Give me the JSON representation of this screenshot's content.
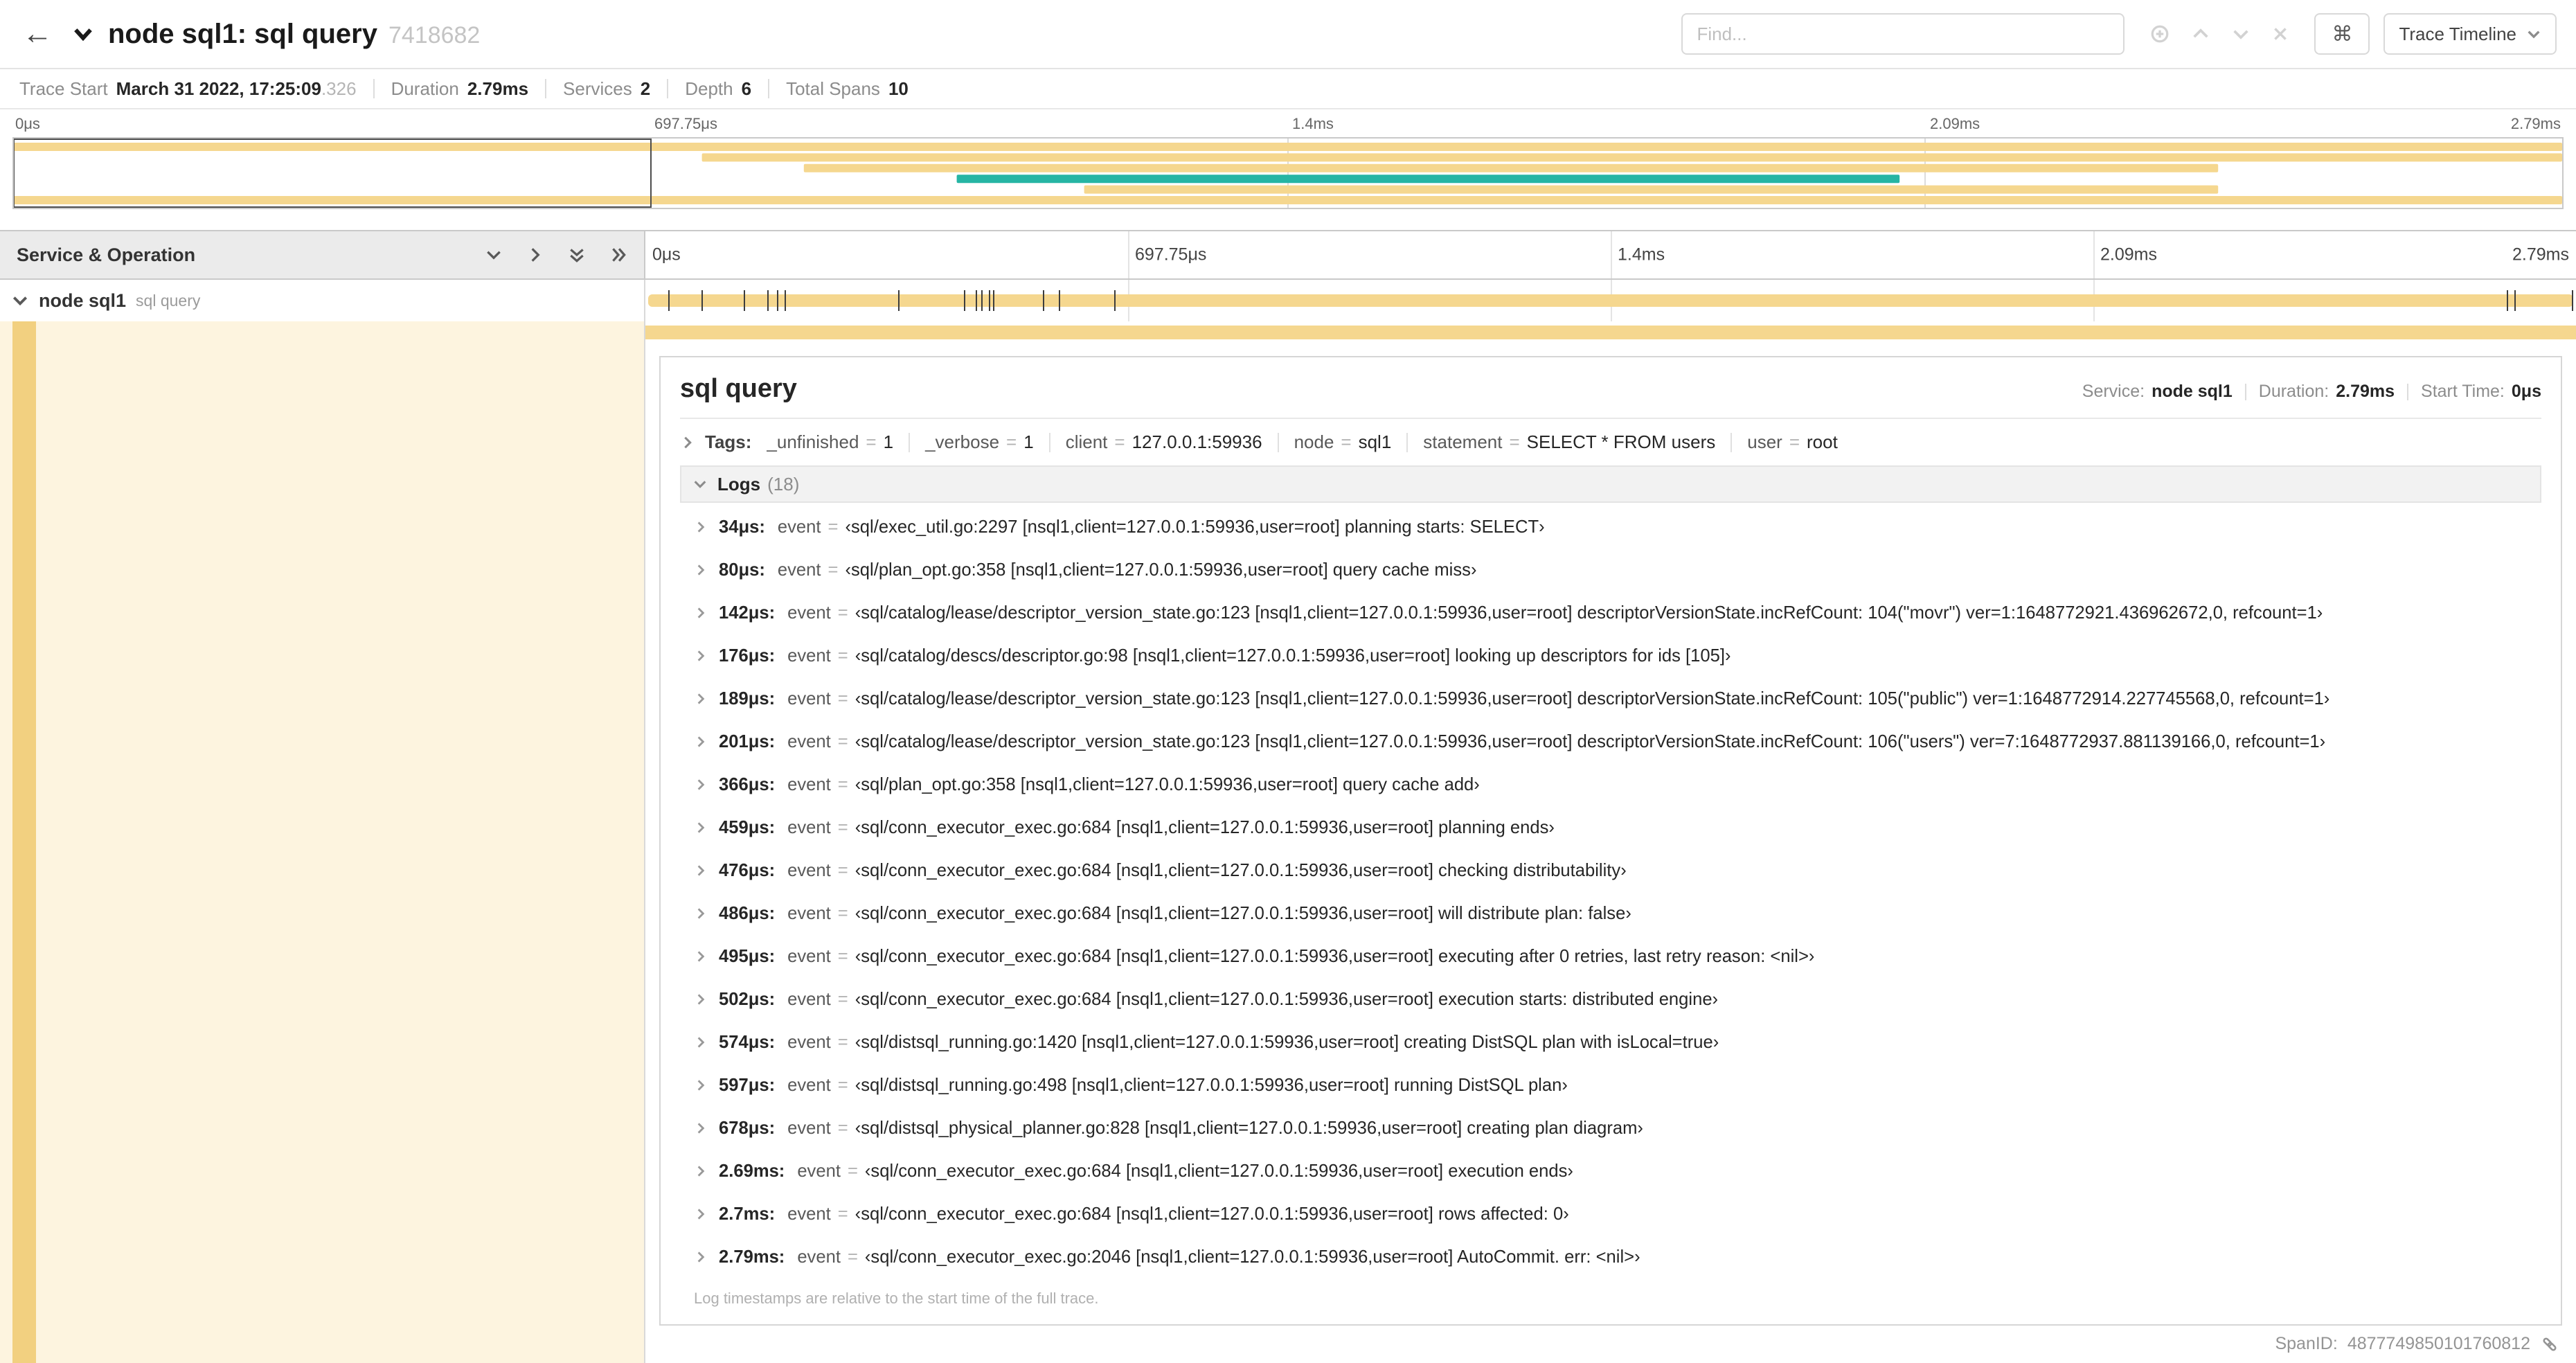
{
  "colors": {
    "tan": "#f5d78f",
    "teal": "#26b5a4",
    "tan_light": "#fdf4df",
    "tan_strip": "#f2d080"
  },
  "glyphs": {
    "back": "←",
    "command": "⌘",
    "eq": "="
  },
  "header": {
    "title": "node sql1: sql query",
    "trace_id": "7418682",
    "find_placeholder": "Find...",
    "view_button": "Trace Timeline"
  },
  "summary": {
    "items": [
      {
        "label": "Trace Start",
        "value": "March 31 2022, 17:25:09",
        "suffix": ".326"
      },
      {
        "label": "Duration",
        "value": "2.79ms",
        "suffix": ""
      },
      {
        "label": "Services",
        "value": "2",
        "suffix": ""
      },
      {
        "label": "Depth",
        "value": "6",
        "suffix": ""
      },
      {
        "label": "Total Spans",
        "value": "10",
        "suffix": ""
      }
    ]
  },
  "timeline": {
    "left_header": "Service & Operation",
    "tick_labels": [
      "0μs",
      "697.75μs",
      "1.4ms",
      "2.09ms",
      "2.79ms"
    ],
    "minimap": {
      "bars": [
        {
          "row": 0,
          "start": 0,
          "end": 100,
          "color": "tan"
        },
        {
          "row": 1,
          "start": 27,
          "end": 100,
          "color": "tan"
        },
        {
          "row": 2,
          "start": 31,
          "end": 86.5,
          "color": "tan"
        },
        {
          "row": 3,
          "start": 37,
          "end": 74,
          "color": "teal"
        },
        {
          "row": 4,
          "start": 42,
          "end": 86.5,
          "color": "tan"
        },
        {
          "row": 5,
          "start": 0,
          "end": 100,
          "color": "tan"
        }
      ],
      "viewport": {
        "start": 0,
        "end": 25
      }
    }
  },
  "span": {
    "service": "node sql1",
    "operation": "sql query",
    "bar_start": 0.15,
    "bar_end": 99.85,
    "log_tick_pcts": [
      1.2,
      2.9,
      5.1,
      6.3,
      6.8,
      7.2,
      13.1,
      16.5,
      17.1,
      17.4,
      17.8,
      18.0,
      20.6,
      21.4,
      24.3,
      96.4,
      96.8,
      99.8
    ]
  },
  "detail": {
    "title": "sql query",
    "meta": [
      {
        "label": "Service:",
        "value": "node sql1"
      },
      {
        "label": "Duration:",
        "value": "2.79ms"
      },
      {
        "label": "Start Time:",
        "value": "0μs"
      }
    ],
    "tags_label": "Tags:",
    "tags": [
      {
        "key": "_unfinished",
        "value": "1"
      },
      {
        "key": "_verbose",
        "value": "1"
      },
      {
        "key": "client",
        "value": "127.0.0.1:59936"
      },
      {
        "key": "node",
        "value": "sql1"
      },
      {
        "key": "statement",
        "value": "SELECT * FROM users"
      },
      {
        "key": "user",
        "value": "root"
      }
    ],
    "logs_label": "Logs",
    "logs_count": "(18)",
    "logs": [
      {
        "time": "34μs:",
        "key": "event",
        "value": "‹sql/exec_util.go:2297 [nsql1,client=127.0.0.1:59936,user=root] planning starts: SELECT›"
      },
      {
        "time": "80μs:",
        "key": "event",
        "value": "‹sql/plan_opt.go:358 [nsql1,client=127.0.0.1:59936,user=root] query cache miss›"
      },
      {
        "time": "142μs:",
        "key": "event",
        "value": "‹sql/catalog/lease/descriptor_version_state.go:123 [nsql1,client=127.0.0.1:59936,user=root] descriptorVersionState.incRefCount: 104(\"movr\") ver=1:1648772921.436962672,0, refcount=1›"
      },
      {
        "time": "176μs:",
        "key": "event",
        "value": "‹sql/catalog/descs/descriptor.go:98 [nsql1,client=127.0.0.1:59936,user=root] looking up descriptors for ids [105]›"
      },
      {
        "time": "189μs:",
        "key": "event",
        "value": "‹sql/catalog/lease/descriptor_version_state.go:123 [nsql1,client=127.0.0.1:59936,user=root] descriptorVersionState.incRefCount: 105(\"public\") ver=1:1648772914.227745568,0, refcount=1›"
      },
      {
        "time": "201μs:",
        "key": "event",
        "value": "‹sql/catalog/lease/descriptor_version_state.go:123 [nsql1,client=127.0.0.1:59936,user=root] descriptorVersionState.incRefCount: 106(\"users\") ver=7:1648772937.881139166,0, refcount=1›"
      },
      {
        "time": "366μs:",
        "key": "event",
        "value": "‹sql/plan_opt.go:358 [nsql1,client=127.0.0.1:59936,user=root] query cache add›"
      },
      {
        "time": "459μs:",
        "key": "event",
        "value": "‹sql/conn_executor_exec.go:684 [nsql1,client=127.0.0.1:59936,user=root] planning ends›"
      },
      {
        "time": "476μs:",
        "key": "event",
        "value": "‹sql/conn_executor_exec.go:684 [nsql1,client=127.0.0.1:59936,user=root] checking distributability›"
      },
      {
        "time": "486μs:",
        "key": "event",
        "value": "‹sql/conn_executor_exec.go:684 [nsql1,client=127.0.0.1:59936,user=root] will distribute plan: false›"
      },
      {
        "time": "495μs:",
        "key": "event",
        "value": "‹sql/conn_executor_exec.go:684 [nsql1,client=127.0.0.1:59936,user=root] executing after 0 retries, last retry reason: <nil>›"
      },
      {
        "time": "502μs:",
        "key": "event",
        "value": "‹sql/conn_executor_exec.go:684 [nsql1,client=127.0.0.1:59936,user=root] execution starts: distributed engine›"
      },
      {
        "time": "574μs:",
        "key": "event",
        "value": "‹sql/distsql_running.go:1420 [nsql1,client=127.0.0.1:59936,user=root] creating DistSQL plan with isLocal=true›"
      },
      {
        "time": "597μs:",
        "key": "event",
        "value": "‹sql/distsql_running.go:498 [nsql1,client=127.0.0.1:59936,user=root] running DistSQL plan›"
      },
      {
        "time": "678μs:",
        "key": "event",
        "value": "‹sql/distsql_physical_planner.go:828 [nsql1,client=127.0.0.1:59936,user=root] creating plan diagram›"
      },
      {
        "time": "2.69ms:",
        "key": "event",
        "value": "‹sql/conn_executor_exec.go:684 [nsql1,client=127.0.0.1:59936,user=root] execution ends›"
      },
      {
        "time": "2.7ms:",
        "key": "event",
        "value": "‹sql/conn_executor_exec.go:684 [nsql1,client=127.0.0.1:59936,user=root] rows affected: 0›"
      },
      {
        "time": "2.79ms:",
        "key": "event",
        "value": "‹sql/conn_executor_exec.go:2046 [nsql1,client=127.0.0.1:59936,user=root] AutoCommit. err: <nil>›"
      }
    ],
    "footer_note": "Log timestamps are relative to the start time of the full trace.",
    "span_id_label": "SpanID:",
    "span_id": "4877749850101760812"
  }
}
